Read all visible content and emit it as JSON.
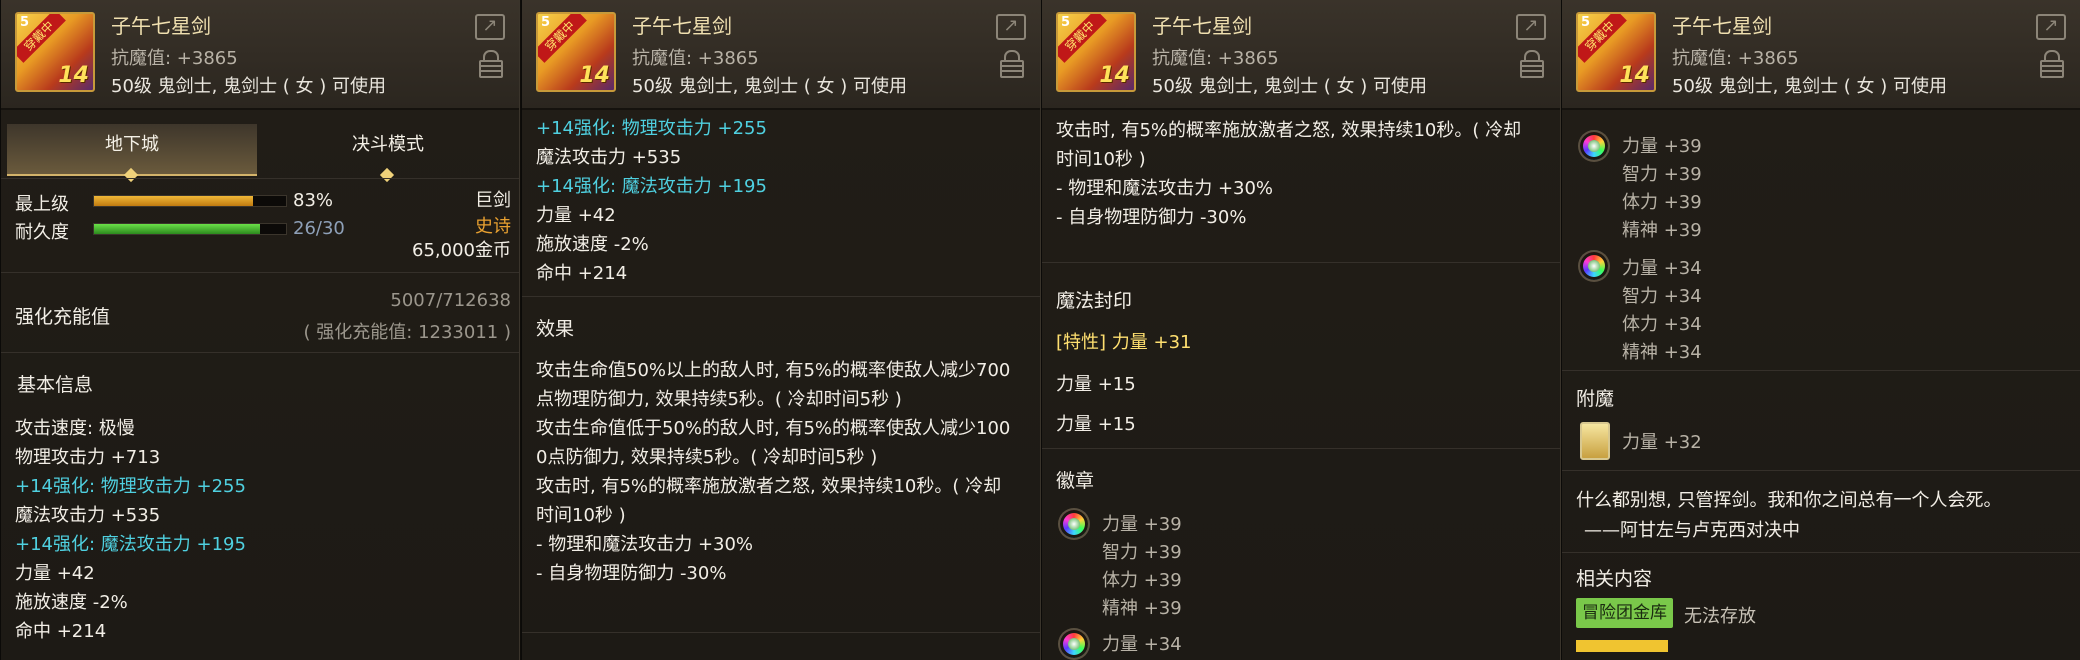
{
  "item": {
    "name": "子午七星剑",
    "resistance": "抗魔值: +3865",
    "usable": "50级 鬼剑士, 鬼剑士 ( 女 ) 可使用",
    "enhance_level": "14",
    "tier_badge": "5",
    "status_tag": "穿戴中"
  },
  "tabs": [
    "地下城",
    "决斗模式"
  ],
  "stats": {
    "max_level_label": "最上级",
    "max_level_value": "83%",
    "max_level_fraction": 0.83,
    "durability_label": "耐久度",
    "durability_value": "26/30",
    "durability_fraction": 0.867,
    "weapon_type": "巨剑",
    "rarity": "史诗",
    "price": "65,000金币"
  },
  "enhance": {
    "label": "强化充能值",
    "value": "5007/712638",
    "sub": "( 强化充能值: 1233011 )"
  },
  "basic_info": {
    "title": "基本信息",
    "lines": [
      {
        "text": "攻击速度: 极慢",
        "kind": "white"
      },
      {
        "text": "物理攻击力 +713",
        "kind": "white"
      },
      {
        "text": "+14强化: 物理攻击力 +255",
        "kind": "cyan"
      },
      {
        "text": "魔法攻击力 +535",
        "kind": "white"
      },
      {
        "text": "+14强化: 魔法攻击力 +195",
        "kind": "cyan"
      },
      {
        "text": "力量 +42",
        "kind": "white"
      },
      {
        "text": "施放速度 -2%",
        "kind": "white"
      },
      {
        "text": "命中 +214",
        "kind": "white"
      }
    ]
  },
  "effect": {
    "title": "效果",
    "lines": [
      "攻击生命值50%以上的敌人时, 有5%的概率使敌人减少700",
      "点物理防御力, 效果持续5秒。( 冷却时间5秒 )",
      "攻击生命值低于50%的敌人时, 有5%的概率使敌人减少100",
      "0点防御力, 效果持续5秒。( 冷却时间5秒 )",
      "攻击时, 有5%的概率施放激者之怒, 效果持续10秒。( 冷却",
      "时间10秒 )",
      "- 物理和魔法攻击力 +30%",
      "- 自身物理防御力 -30%"
    ],
    "p3_lines": [
      "攻击时, 有5%的概率施放激者之怒, 效果持续10秒。( 冷却",
      "时间10秒 )",
      "- 物理和魔法攻击力 +30%",
      "- 自身物理防御力 -30%"
    ]
  },
  "magic_seal": {
    "title": "魔法封印",
    "trait": "[特性] 力量 +31",
    "lines": [
      "力量 +15",
      "力量 +15"
    ]
  },
  "emblem": {
    "title": "徽章",
    "gem1": [
      "力量 +39",
      "智力 +39",
      "体力 +39",
      "精神 +39"
    ],
    "gem2": [
      "力量 +34",
      "智力 +34",
      "体力 +34",
      "精神 +34"
    ]
  },
  "enchant": {
    "title": "附魔",
    "value": "力量 +32"
  },
  "quote": {
    "line1": "什么都别想, 只管挥剑。我和你之间总有一个人会死。",
    "line2": "——阿甘左与卢克西对决中"
  },
  "related": {
    "title": "相关内容",
    "badge": "冒险团金库",
    "badge_text": "无法存放"
  },
  "colors": {
    "accent_gold": "#f4d46a",
    "enhance_cyan": "#4fd0e0",
    "rarity_orange": "#e8a030",
    "max_bar": "#e0a020",
    "durability_bar": "#4cc030"
  },
  "icons": [
    "share-icon",
    "lock-icon",
    "weapon-icon",
    "rainbow-gem-icon",
    "enchant-card-icon"
  ]
}
